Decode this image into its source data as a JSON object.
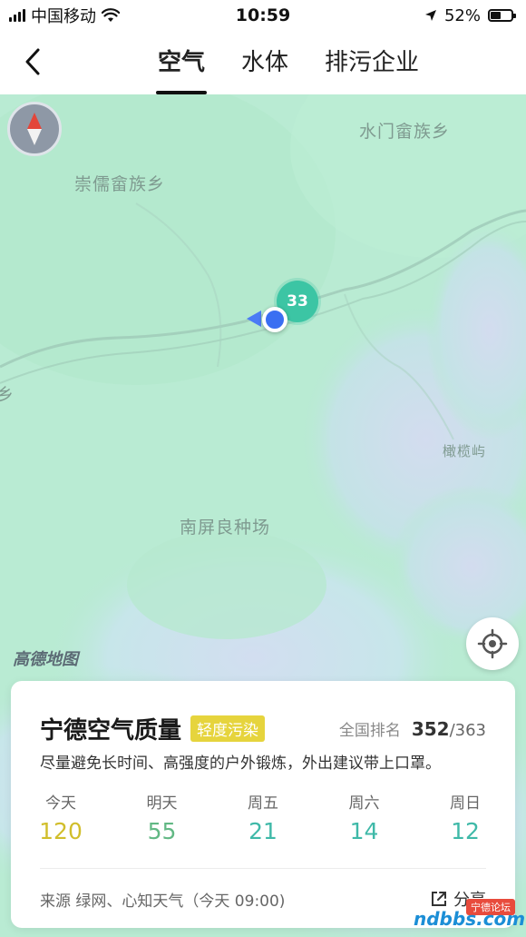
{
  "status_bar": {
    "carrier": "中国移动",
    "time": "10:59",
    "battery_percent": "52%",
    "battery_level": 0.52,
    "icons": [
      "signal-icon",
      "wifi-icon",
      "location-arrow-icon",
      "battery-icon"
    ]
  },
  "nav": {
    "tabs": [
      {
        "label": "空气",
        "active": true
      },
      {
        "label": "水体",
        "active": false
      },
      {
        "label": "排污企业",
        "active": false
      }
    ],
    "icons": [
      "back-chevron-icon"
    ]
  },
  "map": {
    "places": {
      "shuimen": "水门畲族乡",
      "chongru": "崇儒畲族乡",
      "xiang_edge": "乡",
      "ganlanyu": "橄榄屿",
      "nanping": "南屏良种场"
    },
    "cluster_count": "33",
    "logo": "高德地图",
    "colors": {
      "land": "#b8ead2",
      "water": "#cfe3f0",
      "cluster": "#3cc5a4",
      "user": "#3a6ff2"
    },
    "icons": [
      "compass-icon",
      "locate-icon"
    ]
  },
  "air_quality": {
    "title": "宁德空气质量",
    "badge": "轻度污染",
    "rank_label": "全国排名",
    "rank_value": "352",
    "rank_total": "/363",
    "tip": "尽量避免长时间、高强度的户外锻炼，外出建议带上口罩。",
    "forecast": [
      {
        "day": "今天",
        "value": "120",
        "color": "#d1be2c"
      },
      {
        "day": "明天",
        "value": "55",
        "color": "#62b884"
      },
      {
        "day": "周五",
        "value": "21",
        "color": "#3fb9a8"
      },
      {
        "day": "周六",
        "value": "14",
        "color": "#3fb9a8"
      },
      {
        "day": "周日",
        "value": "12",
        "color": "#3fb9a8"
      }
    ],
    "source": "来源 绿网、心知天气（今天 09:00)",
    "share_label": "分享",
    "icons": [
      "share-icon"
    ]
  },
  "watermark": {
    "top": "宁德论坛",
    "main": "ndbbs.com"
  }
}
